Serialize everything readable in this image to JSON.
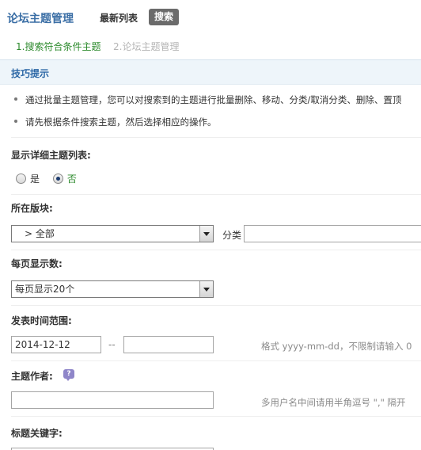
{
  "header": {
    "title": "论坛主题管理",
    "nav_latest": "最新列表",
    "nav_search": "搜索"
  },
  "steps": {
    "step1": "1.搜索符合条件主题",
    "step2": "2.论坛主题管理"
  },
  "tips": {
    "title": "技巧提示",
    "items": [
      "通过批量主题管理，您可以对搜索到的主题进行批量删除、移动、分类/取消分类、删除、置顶",
      "请先根据条件搜索主题，然后选择相应的操作。"
    ]
  },
  "form": {
    "detail_list": {
      "label": "显示详细主题列表:",
      "option_yes": "是",
      "option_no": "否",
      "selected": "否"
    },
    "forum": {
      "label": "所在版块:",
      "selected": "　> 全部",
      "category_label": "分类"
    },
    "per_page": {
      "label": "每页显示数:",
      "selected": "每页显示20个"
    },
    "time_range": {
      "label": "发表时间范围:",
      "start": "2014-12-12",
      "separator": "--",
      "end": "",
      "hint": "格式 yyyy-mm-dd，不限制请输入 0"
    },
    "author": {
      "label": "主题作者:",
      "value": "",
      "hint": "多用户名中间请用半角逗号 \",\" 隔开"
    },
    "keyword": {
      "label": "标题关键字:"
    }
  }
}
